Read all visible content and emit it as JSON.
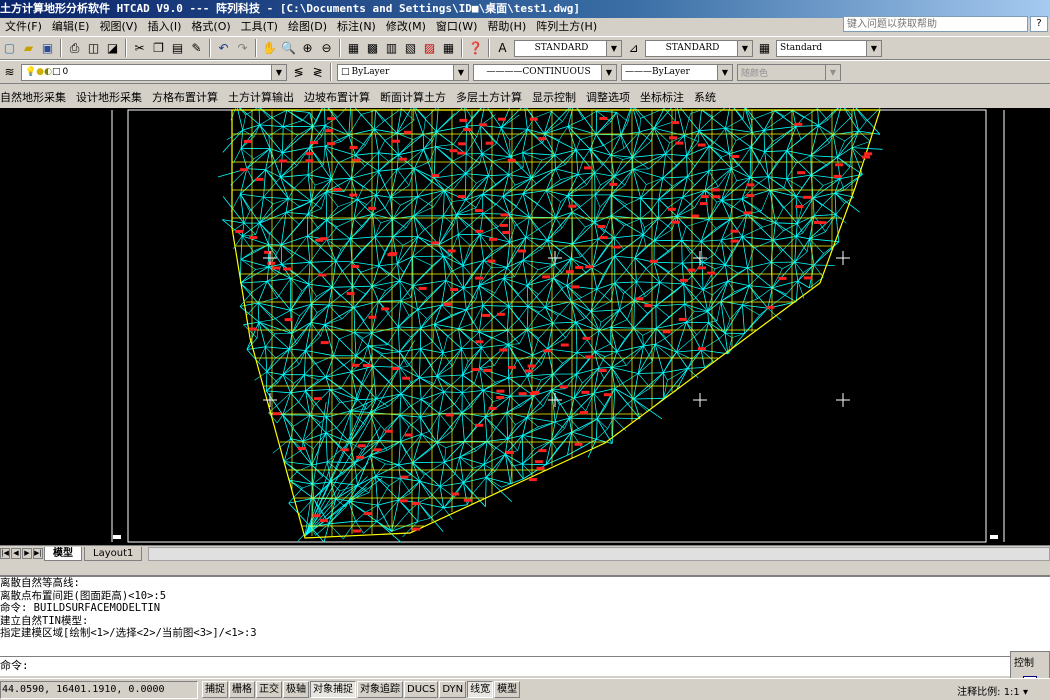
{
  "window": {
    "title": "土方计算地形分析软件 HTCAD V9.0 --- 阵列科技 - [C:\\Documents and Settings\\ID■\\桌面\\test1.dwg]"
  },
  "menubar": {
    "items": [
      "文件(F)",
      "编辑(E)",
      "视图(V)",
      "插入(I)",
      "格式(O)",
      "工具(T)",
      "绘图(D)",
      "标注(N)",
      "修改(M)",
      "窗口(W)",
      "帮助(H)",
      "阵列土方(H)"
    ],
    "help_placeholder": "键入问题以获取帮助",
    "help_button": "?"
  },
  "toolbar1": {
    "text_style": "STANDARD",
    "dim_style": "STANDARD",
    "table_style": "Standard"
  },
  "toolbar2": {
    "layer": "0",
    "color": "ByLayer",
    "linetype": "CONTINUOUS",
    "lineweight": "ByLayer",
    "plot_style": "随颜色"
  },
  "command_menu": {
    "items": [
      "自然地形采集",
      "设计地形采集",
      "方格布置计算",
      "土方计算输出",
      "边坡布置计算",
      "断面计算土方",
      "多层土方计算",
      "显示控制",
      "调整选项",
      "坐标标注",
      "系统"
    ]
  },
  "tabs": {
    "model": "模型",
    "layout1": "Layout1"
  },
  "command_window": {
    "lines": [
      "离散自然等高线:",
      "离散点布置间距(图面距高)<10>:5",
      "命令: BUILDSURFACEMODELTIN",
      "建立自然TIN模型:",
      "指定建模区域[绘制<1>/选择<2>/当前图<3>]/<1>:3"
    ],
    "prompt": "命令:"
  },
  "status": {
    "coords": "44.0590, 16401.1910, 0.0000",
    "toggles": [
      {
        "label": "捕捉",
        "on": false
      },
      {
        "label": "栅格",
        "on": false
      },
      {
        "label": "正交",
        "on": false
      },
      {
        "label": "极轴",
        "on": false
      },
      {
        "label": "对象捕捉",
        "on": true
      },
      {
        "label": "对象追踪",
        "on": false
      },
      {
        "label": "DUCS",
        "on": false
      },
      {
        "label": "DYN",
        "on": false
      },
      {
        "label": "线宽",
        "on": true
      },
      {
        "label": "模型",
        "on": false
      }
    ],
    "annotation_scale_label": "注释比例:",
    "annotation_scale_value": "1:1",
    "control_panel_title": "控制"
  },
  "colors": {
    "mesh": "#00ffff",
    "boundary": "#ffff00",
    "points": "#ff2020",
    "background": "#000000",
    "crosshair": "#ffffff"
  }
}
